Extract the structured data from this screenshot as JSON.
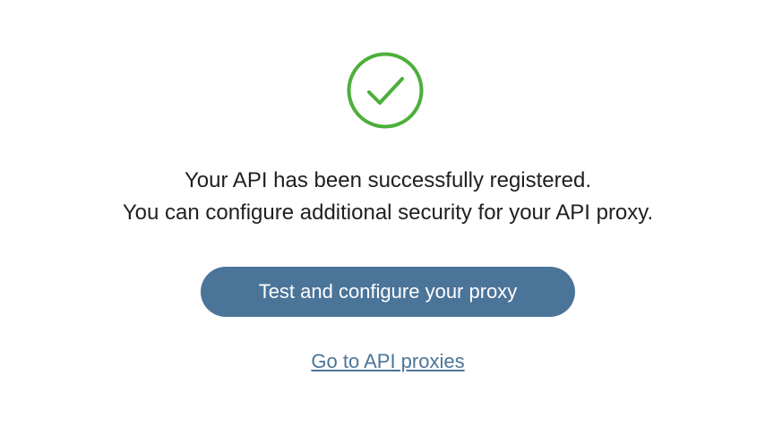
{
  "status": {
    "icon": "check-circle-icon",
    "color": "#4caf3a"
  },
  "message": {
    "line1": "Your API has been successfully registered.",
    "line2": "You can configure additional security for your API proxy."
  },
  "primary_action": {
    "label": "Test and configure your proxy",
    "color": "#4b7499"
  },
  "secondary_action": {
    "label": "Go to API proxies"
  }
}
